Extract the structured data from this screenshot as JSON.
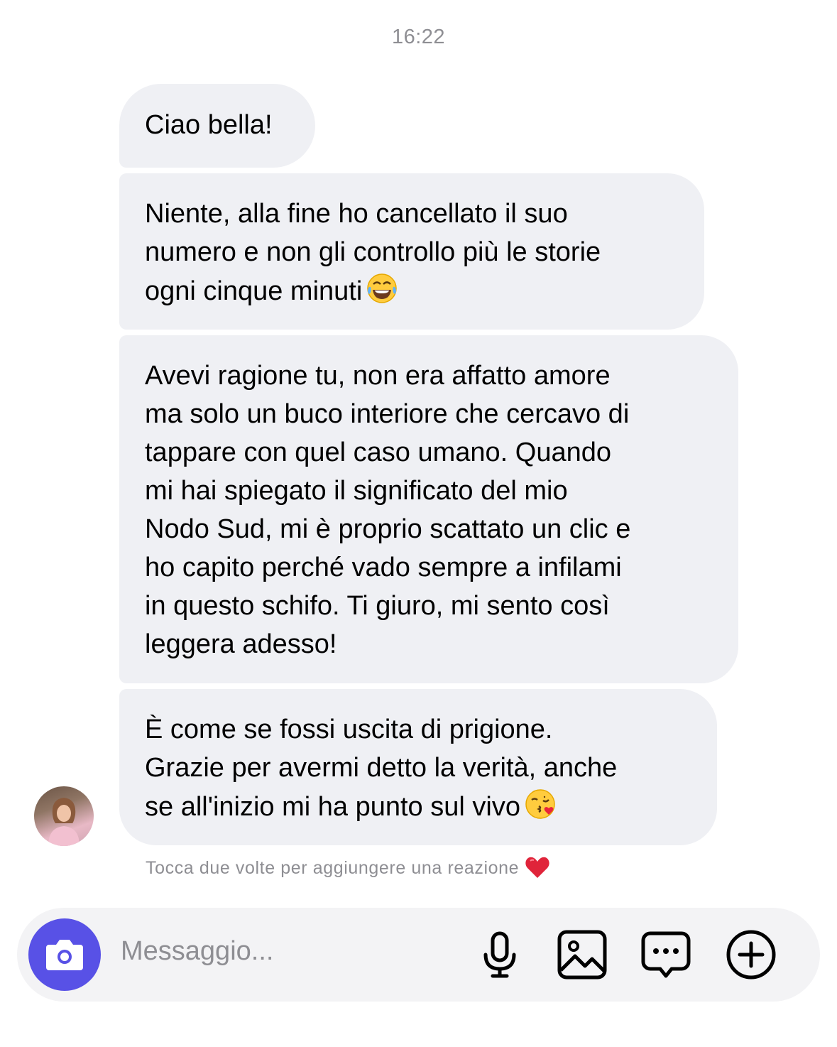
{
  "timestamp": "16:22",
  "messages": [
    {
      "text": "Ciao bella!"
    },
    {
      "text": "Niente, alla fine ho cancellato il suo\nnumero e non gli controllo più le storie\nogni cinque minuti",
      "emoji": "tears-of-joy-emoji"
    },
    {
      "text": "Avevi ragione tu, non era affatto amore\nma solo un buco interiore che cercavo di\ntappare con quel caso umano. Quando\nmi hai spiegato il significato del mio\nNodo Sud, mi è proprio scattato un clic e\nho capito perché vado sempre a infilami\nin questo schifo. Ti giuro, mi sento così\nleggera adesso!"
    },
    {
      "text": "È come se fossi uscita di prigione.\nGrazie per avermi detto la verità, anche\nse all'inizio mi ha punto sul vivo",
      "emoji": "kissing-face-emoji"
    }
  ],
  "reaction_hint": "Tocca due volte per aggiungere una reazione",
  "composer": {
    "placeholder": "Messaggio...",
    "icons": [
      "camera-icon",
      "microphone-icon",
      "gallery-icon",
      "chat-bubble-icon",
      "add-icon"
    ]
  },
  "colors": {
    "bubble": "#eff0f4",
    "accent": "#5851e6",
    "muted_text": "#8e8e93",
    "composer_bg": "#f3f3f5"
  }
}
